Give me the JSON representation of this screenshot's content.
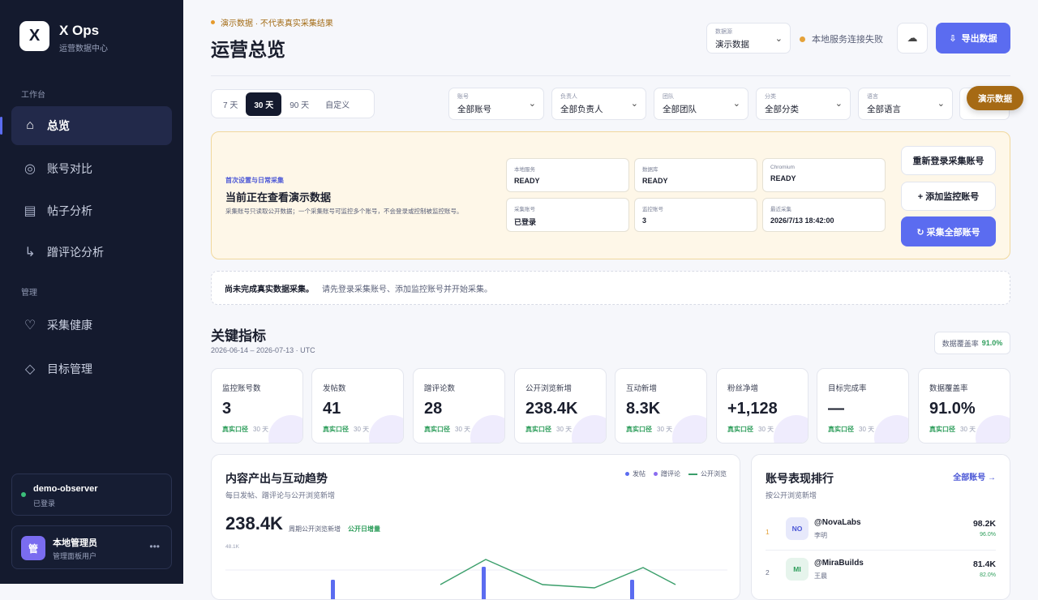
{
  "sidebar": {
    "logo_letter": "X",
    "brand": "X Ops",
    "brand_sub": "运营数据中心",
    "section_workbench": "工作台",
    "section_manage": "管理",
    "items": [
      {
        "label": "总览",
        "icon": "home-icon"
      },
      {
        "label": "账号对比",
        "icon": "target-icon"
      },
      {
        "label": "帖子分析",
        "icon": "list-icon"
      },
      {
        "label": "蹭评论分析",
        "icon": "reply-icon"
      },
      {
        "label": "采集健康",
        "icon": "heart-icon"
      },
      {
        "label": "目标管理",
        "icon": "diamond-icon"
      }
    ],
    "collector": {
      "name": "demo-observer",
      "status": "已登录"
    },
    "user": {
      "avatar": "管",
      "name": "本地管理员",
      "role": "管理面板用户"
    }
  },
  "header": {
    "demo_note": "演示数据 · 不代表真实采集结果",
    "title": "运营总览",
    "datasource_label": "数据源",
    "datasource_value": "演示数据",
    "connection_status": "本地服务连接失败",
    "export_label": "导出数据"
  },
  "filters": {
    "ranges": [
      "7 天",
      "30 天",
      "90 天",
      "自定义"
    ],
    "active_range": "30 天",
    "selects": [
      {
        "label": "账号",
        "value": "全部账号"
      },
      {
        "label": "负责人",
        "value": "全部负责人"
      },
      {
        "label": "团队",
        "value": "全部团队"
      },
      {
        "label": "分类",
        "value": "全部分类"
      },
      {
        "label": "语言",
        "value": "全部语言"
      }
    ],
    "demo_pill": "演示数据"
  },
  "setup": {
    "tag": "首次设置与日常采集",
    "title": "当前正在查看演示数据",
    "desc": "采集账号只读取公开数据；一个采集账号可监控多个账号，不会登录或控制被监控账号。",
    "stats": [
      {
        "label": "本地服务",
        "value": "READY"
      },
      {
        "label": "数据库",
        "value": "READY"
      },
      {
        "label": "Chromium",
        "value": "READY"
      },
      {
        "label": "采集账号",
        "value": "已登录"
      },
      {
        "label": "监控账号",
        "value": "3"
      },
      {
        "label": "最近采集",
        "value": "2026/7/13 18:42:00"
      }
    ],
    "btn_relogin": "重新登录采集账号",
    "btn_add": "+ 添加监控账号",
    "btn_collect": "↻ 采集全部账号"
  },
  "notice": {
    "bold": "尚未完成真实数据采集。",
    "text": "请先登录采集账号、添加监控账号并开始采集。"
  },
  "kpis": {
    "title": "关键指标",
    "range": "2026-06-14 – 2026-07-13 · UTC",
    "coverage_label": "数据覆盖率",
    "coverage_value": "91.0%",
    "items": [
      {
        "label": "监控账号数",
        "value": "3"
      },
      {
        "label": "发帖数",
        "value": "41"
      },
      {
        "label": "蹭评论数",
        "value": "28"
      },
      {
        "label": "公开浏览新增",
        "value": "238.4K"
      },
      {
        "label": "互动新增",
        "value": "8.3K"
      },
      {
        "label": "粉丝净增",
        "value": "+1,128"
      },
      {
        "label": "目标完成率",
        "value": "—"
      },
      {
        "label": "数据覆盖率",
        "value": "91.0%"
      }
    ],
    "footer_tag": "真实口径",
    "footer_period": "30 天"
  },
  "trend": {
    "title": "内容产出与互动趋势",
    "subtitle": "每日发帖、蹭评论与公开浏览新增",
    "legend": [
      "发帖",
      "蹭评论",
      "公开浏览"
    ],
    "colors": {
      "posts": "#5b6cf0",
      "replies": "#8a6cf0",
      "views": "#3a9e6a"
    },
    "big_value": "238.4K",
    "big_label": "周期公开浏览新增",
    "big_tag": "公开日增量",
    "y_tick": "48.1K"
  },
  "ranking": {
    "title": "账号表现排行",
    "subtitle": "按公开浏览新增",
    "all_link": "全部账号 →",
    "rows": [
      {
        "rank": "1",
        "avatar": "NO",
        "handle": "@NovaLabs",
        "owner": "李明",
        "value": "98.2K",
        "pct": "96.0%"
      },
      {
        "rank": "2",
        "avatar": "MI",
        "handle": "@MiraBuilds",
        "owner": "王晨",
        "value": "81.4K",
        "pct": "82.0%"
      }
    ]
  }
}
